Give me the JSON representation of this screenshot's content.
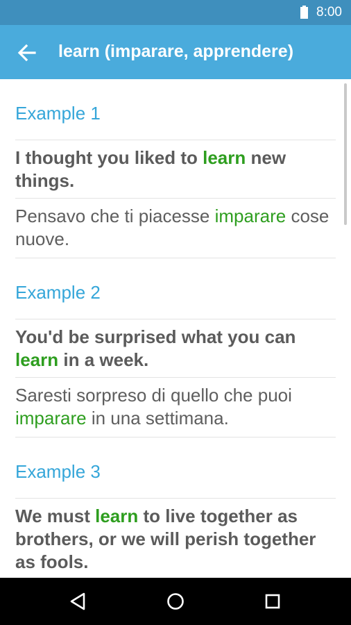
{
  "status_bar": {
    "time": "8:00",
    "battery_icon": "battery-full-icon"
  },
  "app_bar": {
    "title": "learn (imparare, apprendere)",
    "back_icon": "arrow-back-icon"
  },
  "examples": [
    {
      "heading": "Example 1",
      "en": {
        "pre": "I thought you liked to ",
        "hl": "learn",
        "post": " new things."
      },
      "it": {
        "pre": "Pensavo che ti piacesse ",
        "hl": "imparare",
        "post": " cose nuove."
      }
    },
    {
      "heading": "Example 2",
      "en": {
        "pre": "You'd be surprised what you can ",
        "hl": "learn",
        "post": " in a week."
      },
      "it": {
        "pre": "Saresti sorpreso di quello che puoi ",
        "hl": "imparare",
        "post": " in una settimana."
      }
    },
    {
      "heading": "Example 3",
      "en": {
        "pre": "We must ",
        "hl": "learn",
        "post": " to live together as brothers, or we will perish together as fools."
      }
    }
  ],
  "colors": {
    "status_bar": "#3f8fbd",
    "app_bar": "#4aabdc",
    "heading": "#35a6d9",
    "highlight": "#2e9e1f",
    "text": "#5b5b5b"
  },
  "nav_bar": {
    "back_icon": "nav-back-icon",
    "home_icon": "nav-home-icon",
    "recents_icon": "nav-recents-icon"
  }
}
